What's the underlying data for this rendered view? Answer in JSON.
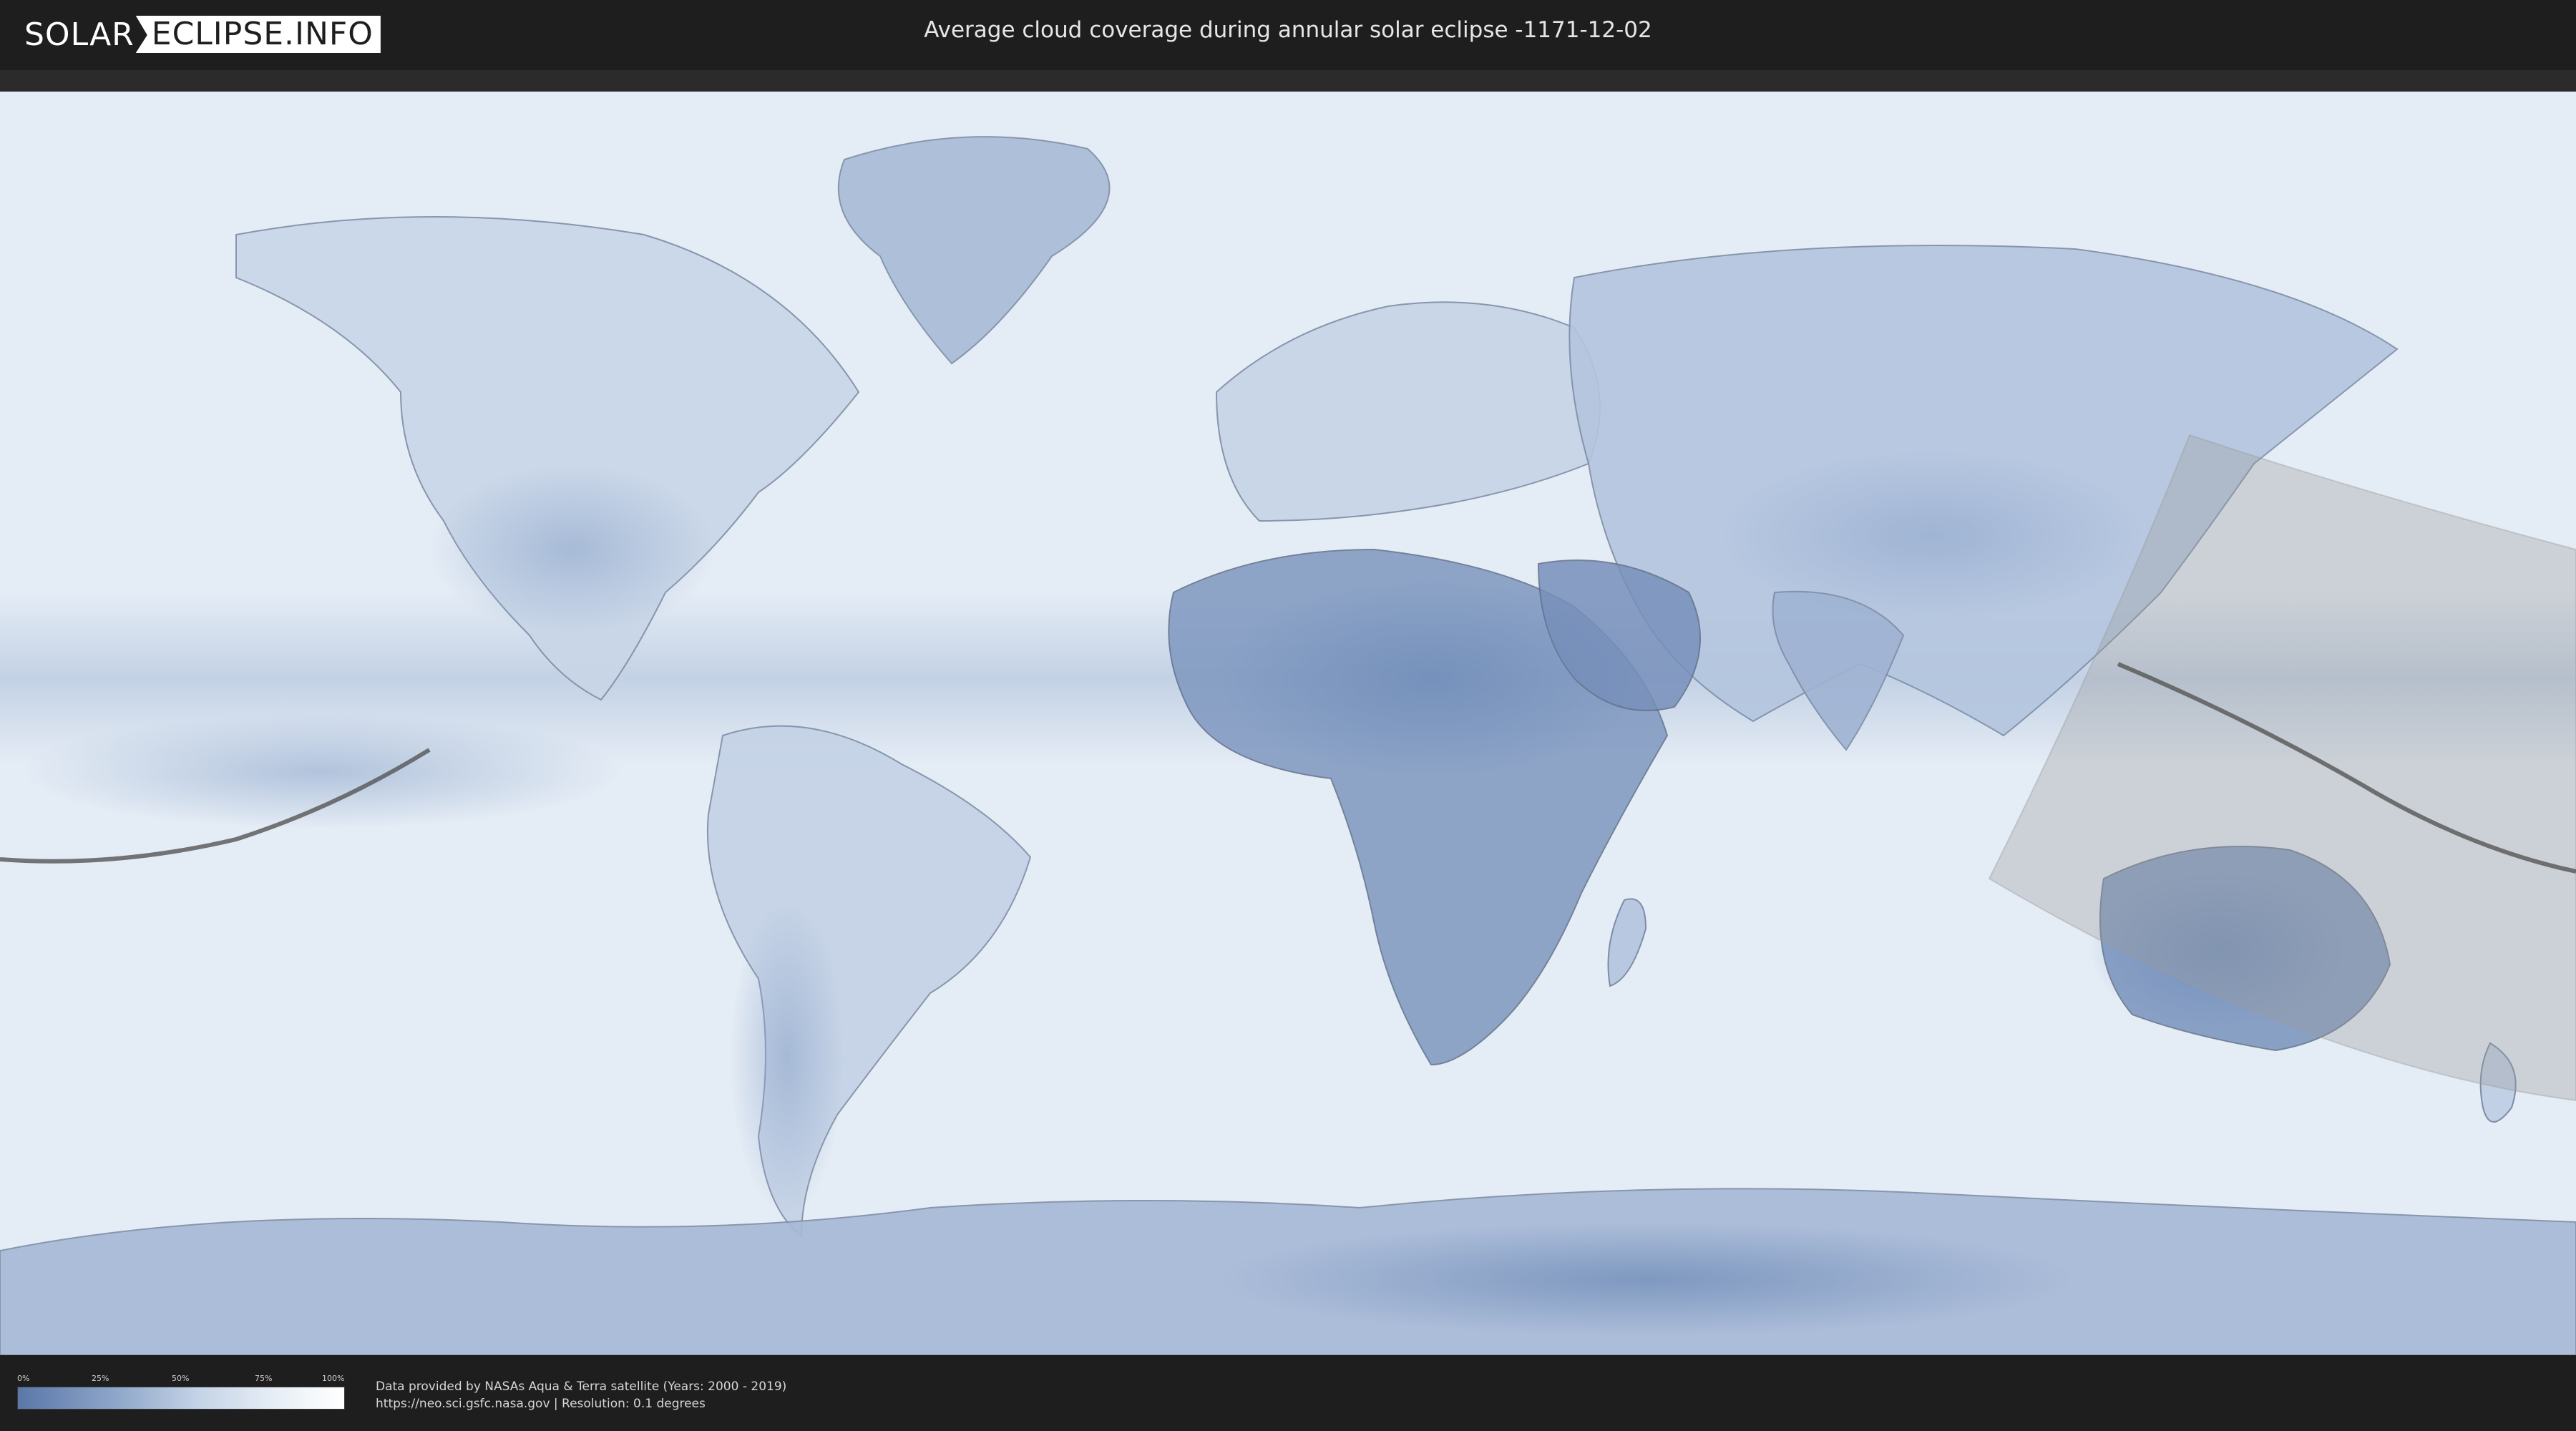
{
  "header": {
    "logo_left": "SOLAR",
    "logo_right": "ECLIPSE.INFO",
    "title": "Average cloud coverage during annular solar eclipse -1171-12-02"
  },
  "legend": {
    "ticks": [
      "0%",
      "25%",
      "50%",
      "75%",
      "100%"
    ],
    "gradient_colors": [
      "#5a77a8",
      "#8ea6c9",
      "#c4d3e6",
      "#e9eff6",
      "#ffffff"
    ]
  },
  "credits": {
    "line1": "Data provided by NASAs Aqua & Terra satellite (Years: 2000 - 2019)",
    "line2": "https://neo.sci.gsfc.nasa.gov | Resolution: 0.1 degrees"
  },
  "map": {
    "background_color": "#dfe8f2",
    "cloud_dark_color": "#6f8cb8",
    "eclipse_zone_color": "#9a9a9a",
    "eclipse_path_color": "#555555"
  }
}
